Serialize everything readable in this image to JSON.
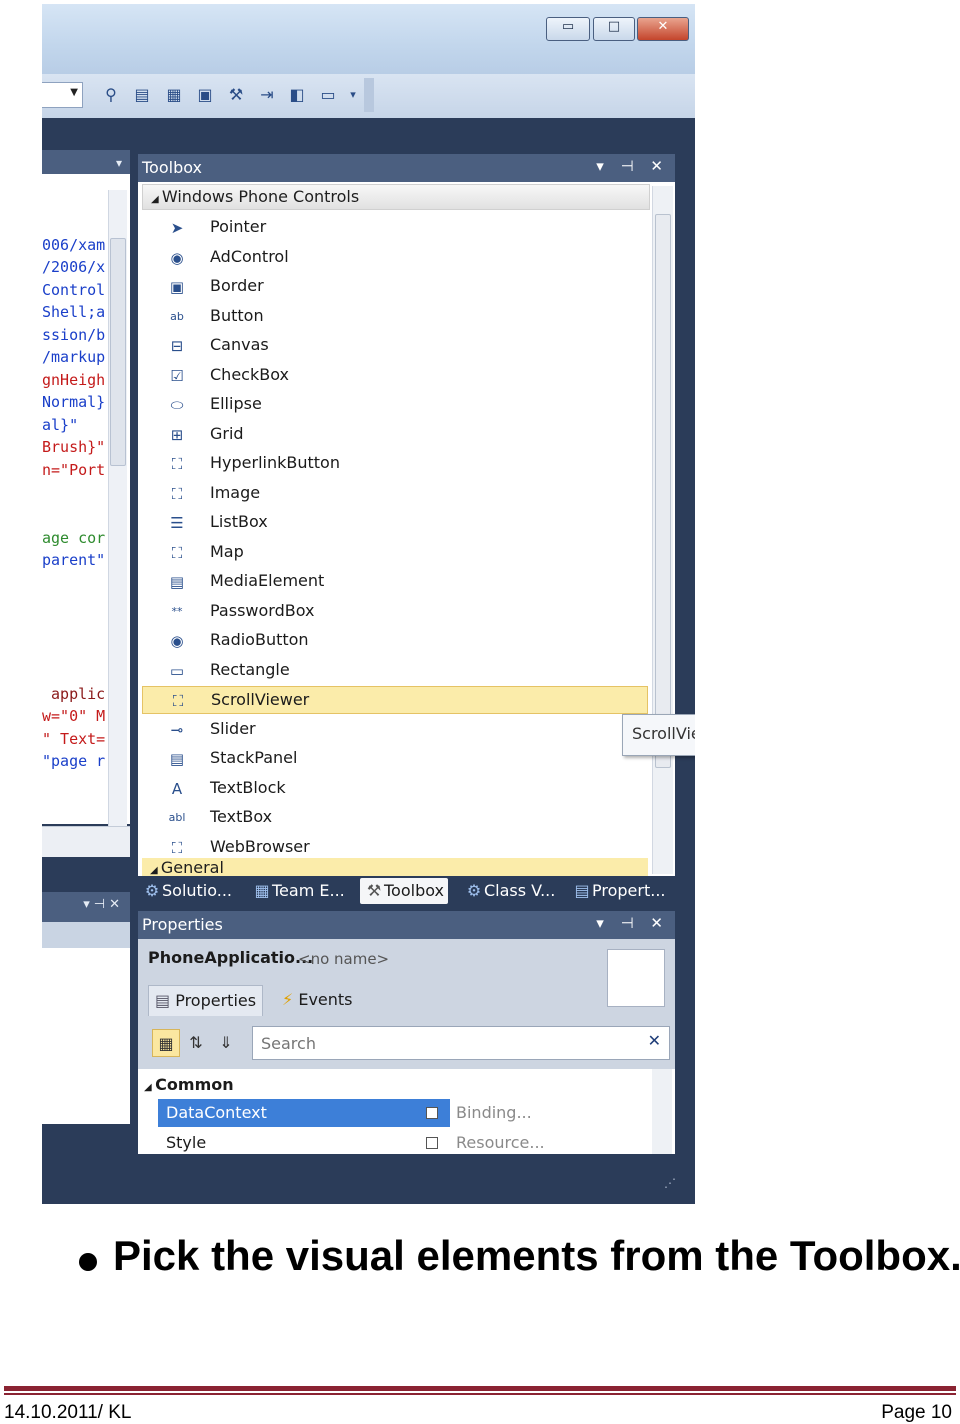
{
  "window": {
    "minimize_glyph": "▭",
    "restore_glyph": "□",
    "close_glyph": "✕"
  },
  "code_lines": [
    {
      "text": "006/xam",
      "color": "#1a3fc9"
    },
    {
      "text": "/2006/x",
      "color": "#1a3fc9"
    },
    {
      "text": "Control",
      "color": "#1a3fc9"
    },
    {
      "text": "Shell;a",
      "color": "#1a3fc9"
    },
    {
      "text": "ssion/b",
      "color": "#1a3fc9"
    },
    {
      "text": "/markup",
      "color": "#1a3fc9"
    },
    {
      "text": "gnHeigh",
      "color": "#c41a1a"
    },
    {
      "text": "Normal}",
      "color": "#1a3fc9"
    },
    {
      "text": "al}\"",
      "color": "#1a3fc9"
    },
    {
      "text": "Brush}\"",
      "color": "#c41a1a"
    },
    {
      "text": "n=\"Port",
      "color": "#c41a1a"
    },
    {
      "text": "age cor",
      "color": "#2e8b2e"
    },
    {
      "text": "parent\"",
      "color": "#1a3fc9"
    },
    {
      "text": " applic",
      "color": "#8b1a1a"
    },
    {
      "text": "w=\"0\" M",
      "color": "#c41a1a"
    },
    {
      "text": "\" Text=",
      "color": "#c41a1a"
    },
    {
      "text": "\"page r",
      "color": "#1a3fc9"
    }
  ],
  "toolbox": {
    "title": "Toolbox",
    "header_controls": "▾ ⊣ ✕",
    "category": "Windows Phone Controls",
    "category_general": "General",
    "items": [
      {
        "label": "Pointer",
        "icon": "pointer-icon",
        "glyph": "➤"
      },
      {
        "label": "AdControl",
        "icon": "adcontrol-icon",
        "glyph": "◉"
      },
      {
        "label": "Border",
        "icon": "border-icon",
        "glyph": "▣"
      },
      {
        "label": "Button",
        "icon": "button-icon",
        "glyph": "ab"
      },
      {
        "label": "Canvas",
        "icon": "canvas-icon",
        "glyph": "⊟"
      },
      {
        "label": "CheckBox",
        "icon": "checkbox-icon",
        "glyph": "☑"
      },
      {
        "label": "Ellipse",
        "icon": "ellipse-icon",
        "glyph": "⬭"
      },
      {
        "label": "Grid",
        "icon": "grid-icon",
        "glyph": "⊞"
      },
      {
        "label": "HyperlinkButton",
        "icon": "hyperlinkbutton-icon",
        "glyph": "⛶"
      },
      {
        "label": "Image",
        "icon": "image-icon",
        "glyph": "⛶"
      },
      {
        "label": "ListBox",
        "icon": "listbox-icon",
        "glyph": "☰"
      },
      {
        "label": "Map",
        "icon": "map-icon",
        "glyph": "⛶"
      },
      {
        "label": "MediaElement",
        "icon": "mediaelement-icon",
        "glyph": "▤"
      },
      {
        "label": "PasswordBox",
        "icon": "passwordbox-icon",
        "glyph": "**"
      },
      {
        "label": "RadioButton",
        "icon": "radiobutton-icon",
        "glyph": "◉"
      },
      {
        "label": "Rectangle",
        "icon": "rectangle-icon",
        "glyph": "▭"
      },
      {
        "label": "ScrollViewer",
        "icon": "scrollviewer-icon",
        "glyph": "⛶"
      },
      {
        "label": "Slider",
        "icon": "slider-icon",
        "glyph": "⊸"
      },
      {
        "label": "StackPanel",
        "icon": "stackpanel-icon",
        "glyph": "▤"
      },
      {
        "label": "TextBlock",
        "icon": "textblock-icon",
        "glyph": "A"
      },
      {
        "label": "TextBox",
        "icon": "textbox-icon",
        "glyph": "abl"
      },
      {
        "label": "WebBrowser",
        "icon": "webbrowser-icon",
        "glyph": "⛶"
      }
    ],
    "selected": "ScrollViewer",
    "tooltip": "ScrollVie"
  },
  "tabs": [
    {
      "label": "Solutio...",
      "icon": "solution-explorer-icon",
      "glyph": "⚙"
    },
    {
      "label": "Team E...",
      "icon": "team-explorer-icon",
      "glyph": "▦"
    },
    {
      "label": "Toolbox",
      "icon": "toolbox-icon",
      "glyph": "⚒",
      "active": true
    },
    {
      "label": "Class V...",
      "icon": "class-view-icon",
      "glyph": "⚙"
    },
    {
      "label": "Propert...",
      "icon": "properties-icon",
      "glyph": "▤"
    }
  ],
  "properties": {
    "title": "Properties",
    "header_controls": "▾ ⊣ ✕",
    "object_type": "PhoneApplicatio...",
    "object_name": "<no name>",
    "tab_properties": "Properties",
    "tab_events": "Events",
    "search_placeholder": "Search",
    "category": "Common",
    "rows": [
      {
        "name": "DataContext",
        "value": "Binding...",
        "selected": true
      },
      {
        "name": "Style",
        "value": "Resource...",
        "selected": false
      }
    ]
  },
  "slide": {
    "bullet": "Pick the visual elements from the Toolbox.",
    "footer_left": "14.10.2011/ KL",
    "footer_right": "Page 10"
  },
  "colors": {
    "accent_rule": "#8a2332",
    "panel_header": "#4b5f80",
    "selection_highlight": "#fbecaa"
  }
}
